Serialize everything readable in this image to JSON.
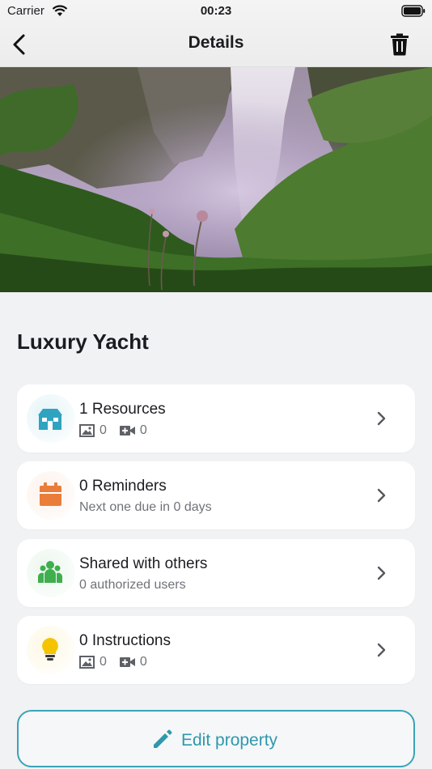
{
  "status_bar": {
    "carrier": "Carrier",
    "time": "00:23"
  },
  "nav": {
    "title": "Details",
    "back_icon": "chevron-left-icon",
    "delete_icon": "trash-icon"
  },
  "hero": {
    "description_icon": "waterfall-photo"
  },
  "property": {
    "name": "Luxury Yacht"
  },
  "cards": [
    {
      "title": "1 Resources",
      "photos": "0",
      "videos": "0",
      "icon": "house-icon",
      "color": "#2ea4c0"
    },
    {
      "title": "0 Reminders",
      "subtitle": "Next one due in 0 days",
      "icon": "calendar-icon",
      "color": "#ea7d3a"
    },
    {
      "title": "Shared with others",
      "subtitle": "0 authorized users",
      "icon": "people-icon",
      "color": "#3fae4e"
    },
    {
      "title": "0 Instructions",
      "photos": "0",
      "videos": "0",
      "icon": "lightbulb-icon",
      "color": "#f5c400"
    }
  ],
  "edit_button": {
    "label": "Edit property",
    "icon": "pencil-icon",
    "color": "#2f98ad"
  }
}
